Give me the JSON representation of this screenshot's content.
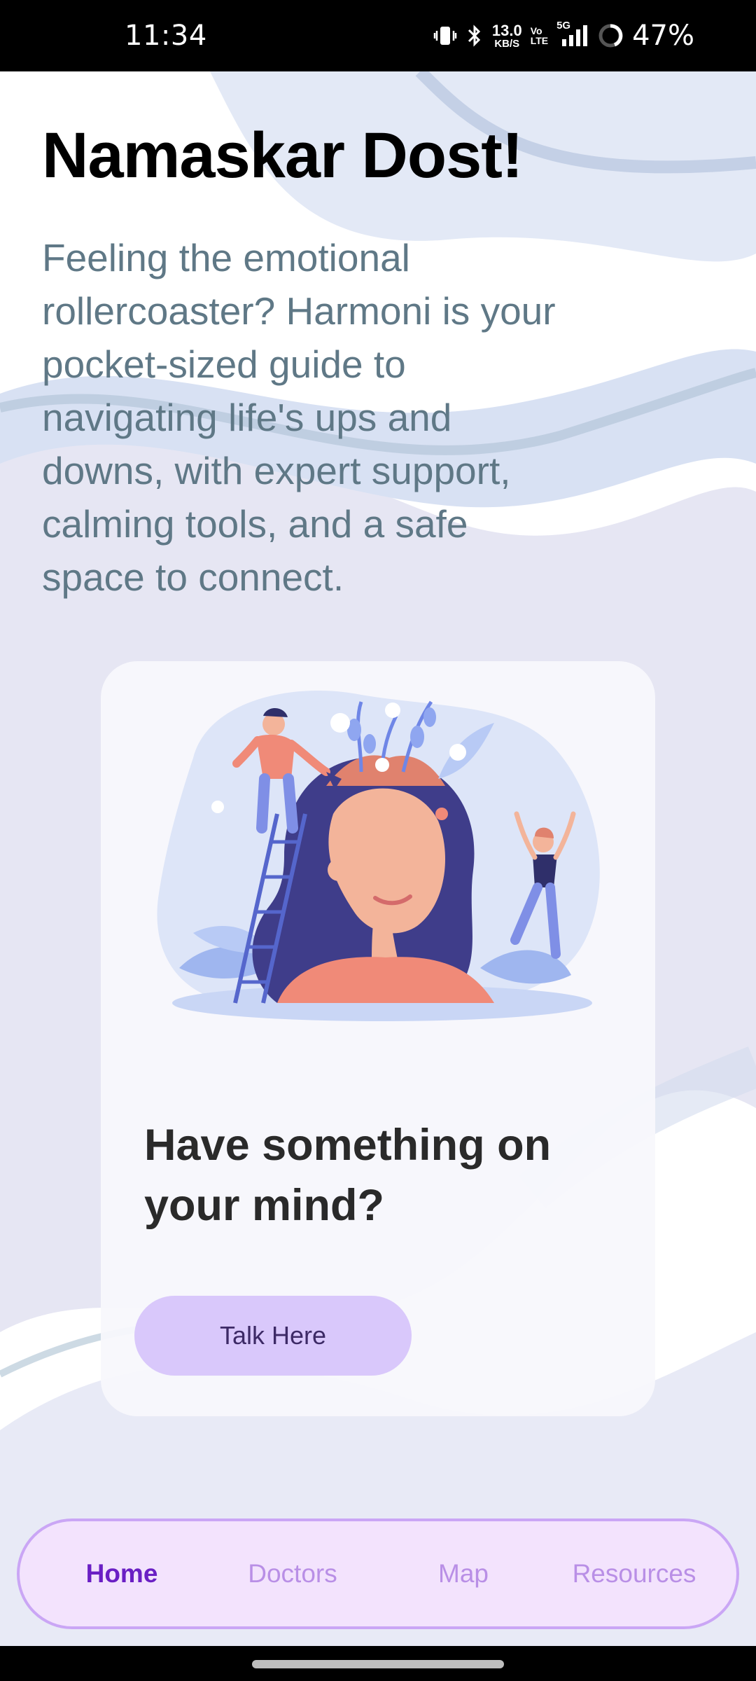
{
  "status_bar": {
    "time": "11:34",
    "net_speed_value": "13.0",
    "net_speed_unit": "KB/S",
    "volte_top": "Vo",
    "volte_bottom": "LTE",
    "network_type": "5G",
    "battery_percent": "47%",
    "icons": [
      "vibrate-icon",
      "bluetooth-icon",
      "signal-icon",
      "battery-icon"
    ]
  },
  "header": {
    "greeting": "Namaskar Dost!",
    "intro": "Feeling the emotional rollercoaster? Harmoni is your pocket-sized guide to navigating life's ups and downs, with expert support, calming tools, and a safe space to connect."
  },
  "card": {
    "question": "Have something on your mind?",
    "button_label": "Talk Here",
    "illustration": "mind-garden-illustration"
  },
  "nav": {
    "items": [
      {
        "label": "Home",
        "active": true
      },
      {
        "label": "Doctors",
        "active": false
      },
      {
        "label": "Map",
        "active": false
      },
      {
        "label": "Resources",
        "active": false
      }
    ]
  },
  "colors": {
    "accent": "#6a1fc4",
    "nav_inactive": "#b98fe6",
    "button_bg": "#d9c8fb",
    "nav_bg": "#f3e3fd",
    "intro_text": "#5f7886"
  }
}
